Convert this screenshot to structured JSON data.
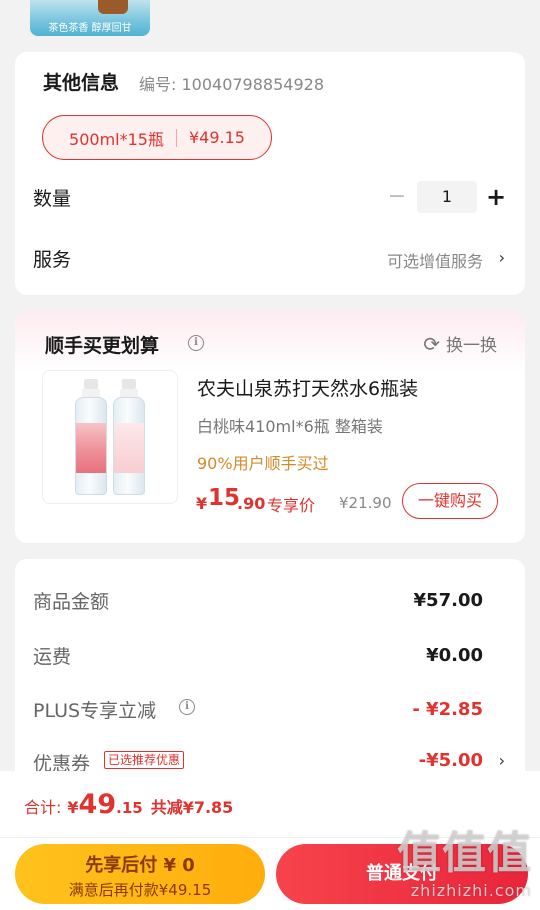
{
  "top_image": {
    "caption": "茶色茶香 醇厚回甘"
  },
  "other_info": {
    "title": "其他信息",
    "sku_label": "编号: 10040798854928",
    "spec": {
      "size": "500ml*15瓶",
      "price": "¥49.15"
    },
    "quantity": {
      "label": "数量",
      "minus": "−",
      "value": "1",
      "plus": "+"
    },
    "service": {
      "label": "服务",
      "value": "可选增值服务"
    }
  },
  "deal": {
    "title": "顺手买更划算",
    "swap_label": "换一换",
    "product": {
      "name": "农夫山泉苏打天然水6瓶装",
      "spec": "白桃味410ml*6瓶   整箱装",
      "hint": "90%用户顺手买过",
      "price_yen": "¥",
      "price_int": "15",
      "price_dec": ".90",
      "price_tag": "专享价",
      "old_price": "¥21.90",
      "buy_label": "一键购买"
    }
  },
  "summary": {
    "rows": [
      {
        "label": "商品金额",
        "value": "¥57.00"
      },
      {
        "label": "运费",
        "value": "¥0.00"
      },
      {
        "label": "PLUS专享立减",
        "value": "- ¥2.85"
      },
      {
        "label": "优惠券",
        "tag": "已选推荐优惠",
        "value": "-¥5.00"
      }
    ]
  },
  "bottom": {
    "total_label": "合计:",
    "total_yen": "¥",
    "total_int": "49",
    "total_dec": ".15",
    "save_label": "共减¥7.85",
    "pay_later_title": "先享后付 ¥ 0",
    "pay_later_sub": "满意后再付款¥49.15",
    "pay_normal": "普通支付"
  },
  "watermark": {
    "big": "值值值",
    "small": "zhizhizhi.com"
  },
  "colors": {
    "accent_red": "#e0332f",
    "pay_later_yellow": "#ffb814",
    "hint_orange": "#d48a2a"
  }
}
